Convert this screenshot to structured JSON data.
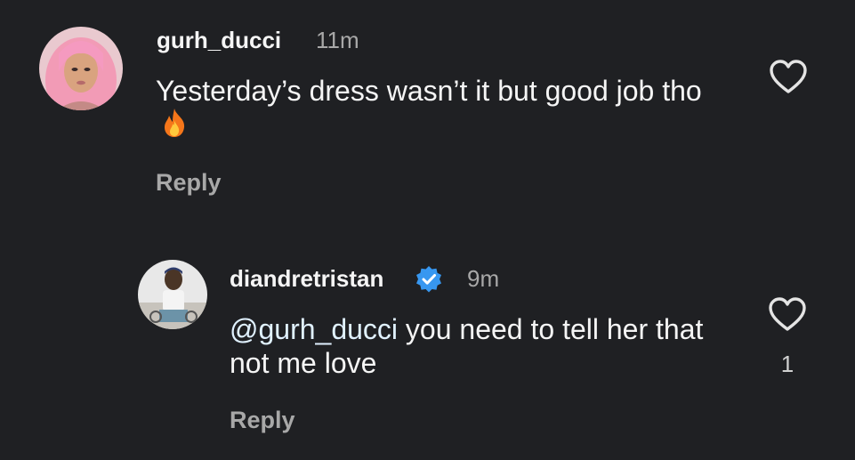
{
  "comments": [
    {
      "username": "gurh_ducci",
      "time": "11m",
      "text": "Yesterday’s dress wasn’t it but good job tho",
      "emoji": "fire-emoji",
      "reply_label": "Reply",
      "like_icon": "heart-outline-icon"
    },
    {
      "username": "diandretristan",
      "verified_icon": "verified-badge-icon",
      "time": "9m",
      "mention": "@gurh_ducci",
      "text": " you need to tell her that not me love",
      "reply_label": "Reply",
      "like_icon": "heart-outline-icon",
      "like_count": "1"
    }
  ],
  "colors": {
    "background": "#1f2023",
    "verified": "#3797f0",
    "secondary_text": "#a8a8a8"
  }
}
